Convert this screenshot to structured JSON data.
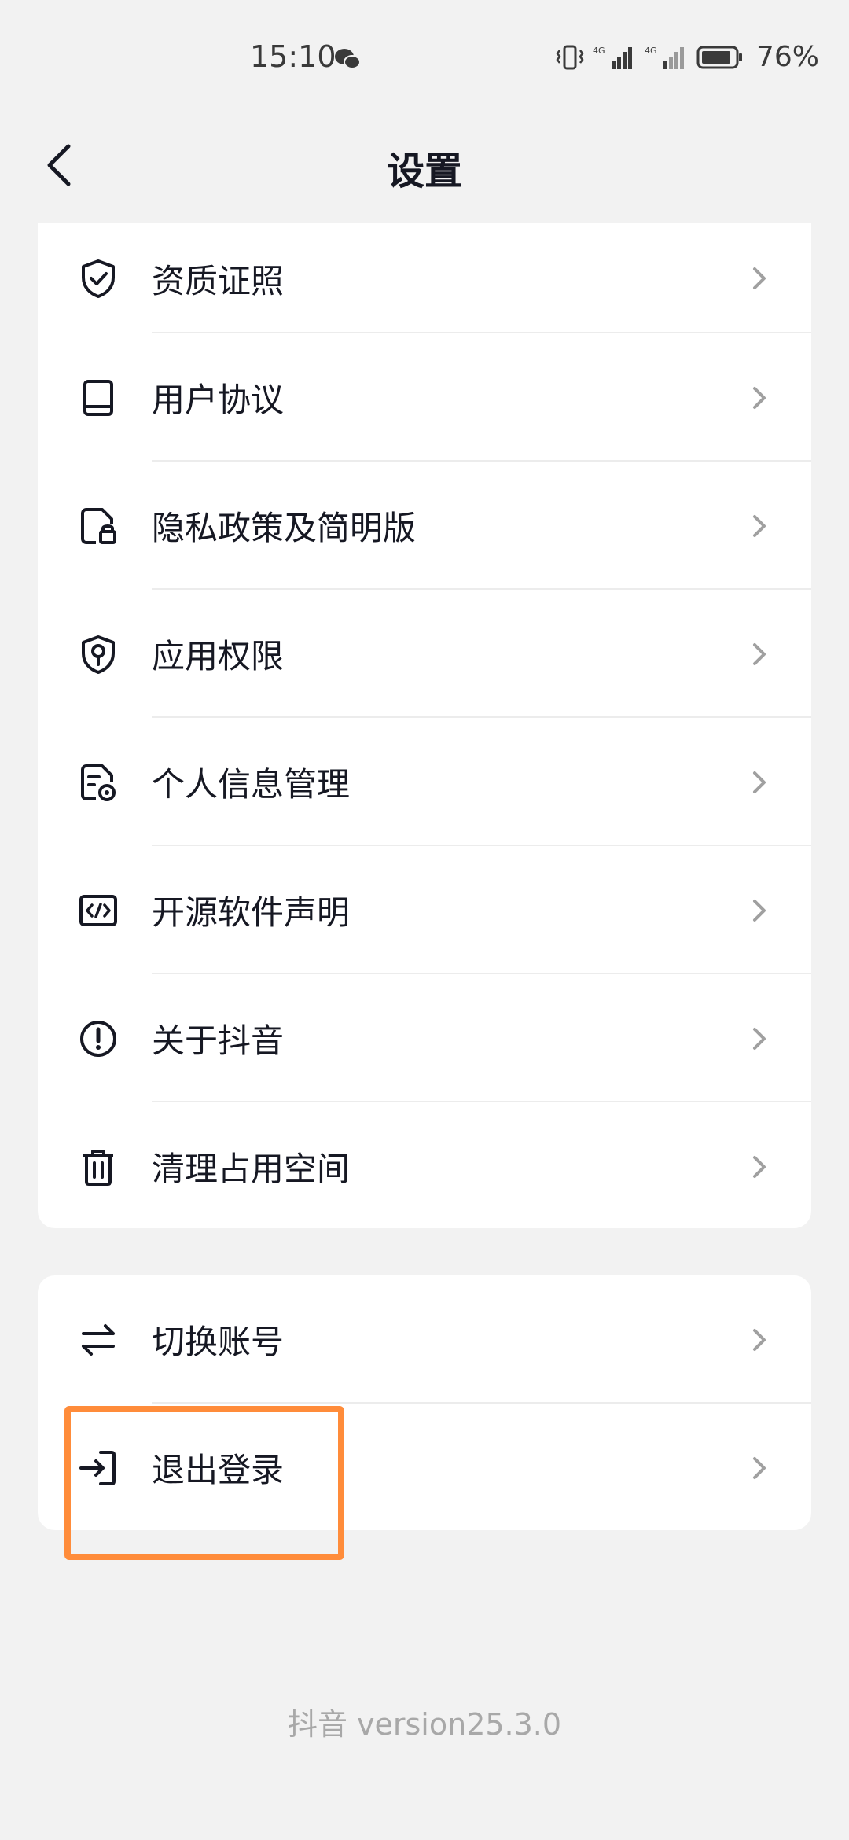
{
  "status_bar": {
    "time": "15:10",
    "network_1": "4G",
    "network_2": "4G",
    "battery": "76%",
    "icons": [
      "wechat-icon",
      "vibrate-icon",
      "signal-icon",
      "battery-icon"
    ]
  },
  "nav": {
    "title": "设置",
    "back_icon": "chevron-left-icon"
  },
  "settings_group_1": [
    {
      "label": "资质证照",
      "icon": "shield-check-icon"
    },
    {
      "label": "用户协议",
      "icon": "book-icon"
    },
    {
      "label": "隐私政策及简明版",
      "icon": "document-lock-icon"
    },
    {
      "label": "应用权限",
      "icon": "shield-key-icon"
    },
    {
      "label": "个人信息管理",
      "icon": "document-gear-icon"
    },
    {
      "label": "开源软件声明",
      "icon": "code-icon"
    },
    {
      "label": "关于抖音",
      "icon": "info-circle-icon"
    },
    {
      "label": "清理占用空间",
      "icon": "trash-icon"
    }
  ],
  "settings_group_2": [
    {
      "label": "切换账号",
      "icon": "swap-icon"
    },
    {
      "label": "退出登录",
      "icon": "logout-icon"
    }
  ],
  "footer": {
    "version": "抖音 version25.3.0"
  },
  "colors": {
    "background": "#f2f2f2",
    "card": "#ffffff",
    "text": "#161823",
    "secondary": "#a8a8a8",
    "highlight": "#ff8c3a"
  }
}
